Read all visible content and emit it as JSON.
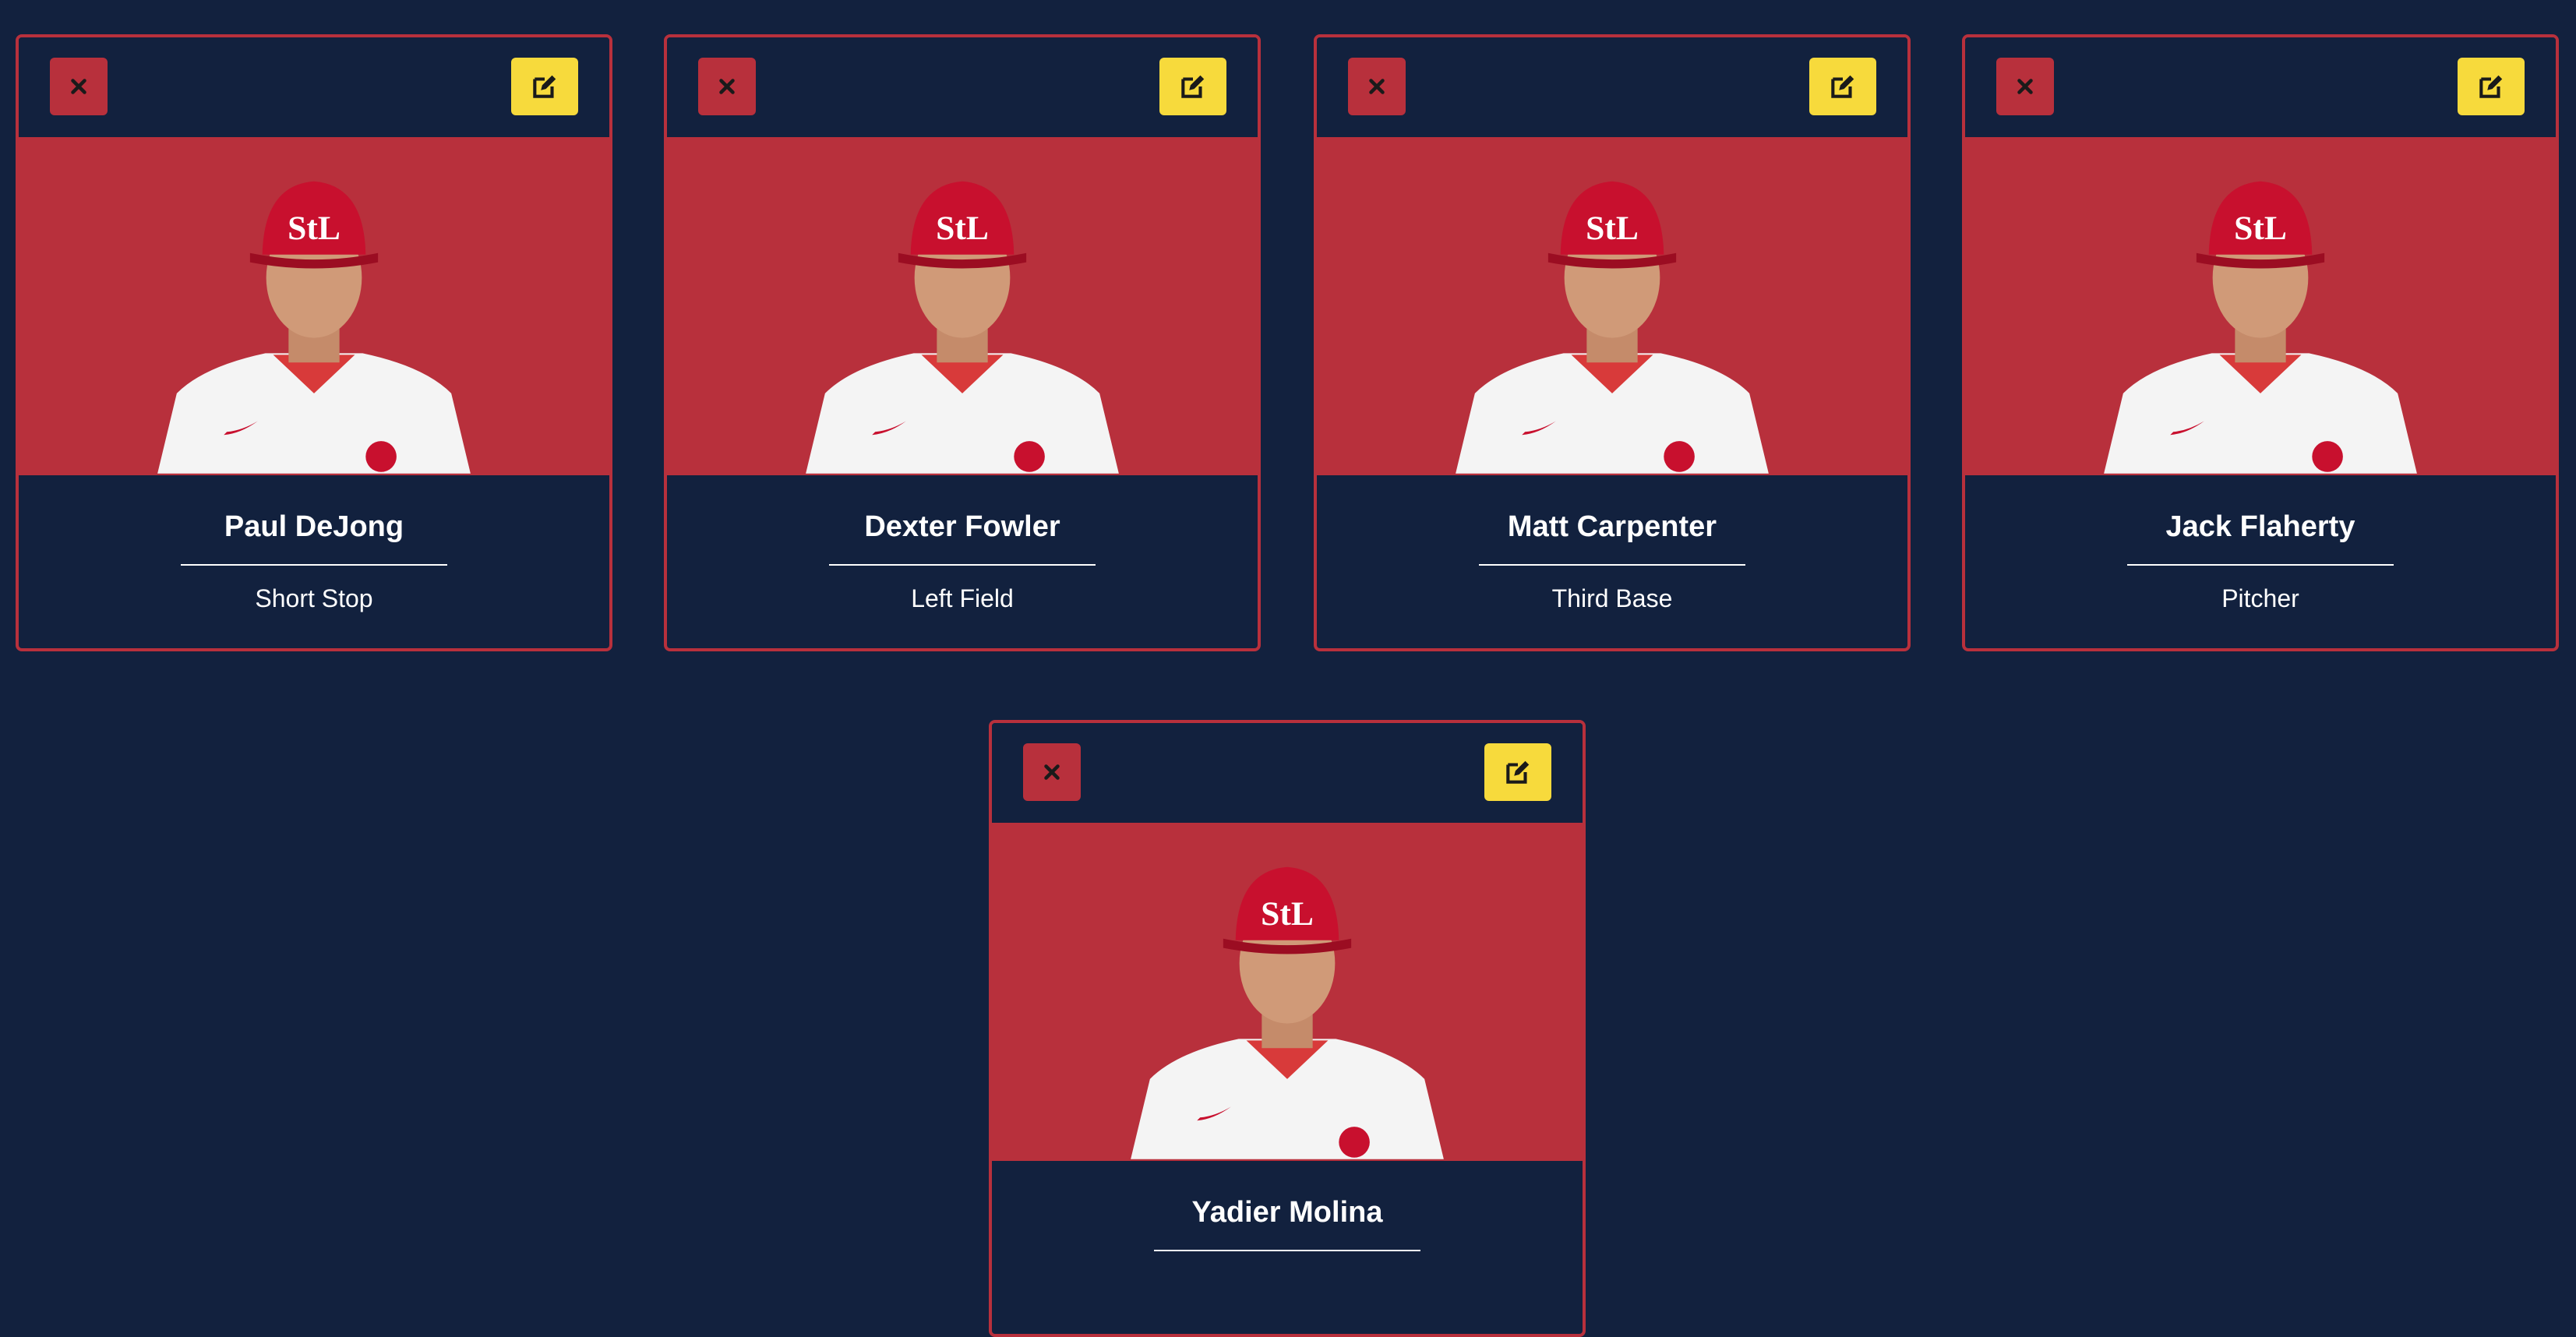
{
  "colors": {
    "page_background": "#12213e",
    "card_border": "#b8303c",
    "photo_background": "#b8303c",
    "delete_button": "#b8303c",
    "edit_button": "#f7da3c",
    "text": "#ffffff"
  },
  "icons": {
    "delete": "close-icon",
    "edit": "edit-icon",
    "logo": "stl-logo"
  },
  "players": [
    {
      "name": "Paul DeJong",
      "position": "Short Stop"
    },
    {
      "name": "Dexter Fowler",
      "position": "Left Field"
    },
    {
      "name": "Matt Carpenter",
      "position": "Third Base"
    },
    {
      "name": "Jack Flaherty",
      "position": "Pitcher"
    },
    {
      "name": "Yadier Molina",
      "position": ""
    }
  ]
}
